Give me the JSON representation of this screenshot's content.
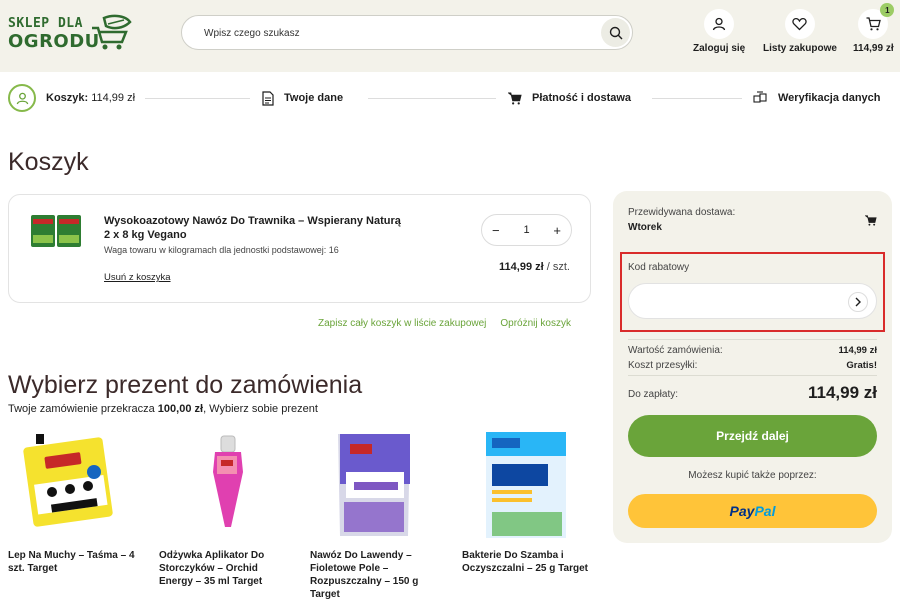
{
  "header": {
    "logo_line1": "SKLEP DLA",
    "logo_line2": "OGRODU",
    "search_placeholder": "Wpisz czego szukasz",
    "login_label": "Zaloguj się",
    "wishlist_label": "Listy zakupowe",
    "cart_total": "114,99 zł",
    "cart_count": "1"
  },
  "steps": [
    {
      "label": "Koszyk:",
      "value": "114,99 zł",
      "icon": "cart-check-icon"
    },
    {
      "label": "Twoje dane",
      "icon": "document-icon"
    },
    {
      "label": "Płatność i dostawa",
      "icon": "cart-icon"
    },
    {
      "label": "Weryfikacja danych",
      "icon": "boxes-icon"
    }
  ],
  "page_title": "Koszyk",
  "cart_item": {
    "name": "Wysokoazotowy Nawóz Do Trawnika – Wspierany Naturą 2 x 8 kg Vegano",
    "meta": "Waga towaru w kilogramach dla jednostki podstawowej: 16",
    "remove_label": "Usuń z koszyka",
    "quantity": "1",
    "minus": "−",
    "plus": "+",
    "price": "114,99 zł",
    "price_unit": "/ szt."
  },
  "cart_actions": {
    "save_list": "Zapisz cały koszyk w liście zakupowej",
    "empty_cart": "Opróżnij koszyk"
  },
  "gifts": {
    "title": "Wybierz prezent do zamówienia",
    "subtitle_pre": "Twoje zamówienie przekracza ",
    "subtitle_amount": "100,00 zł",
    "subtitle_post": ", Wybierz sobie prezent",
    "items": [
      {
        "name": "Lep Na Muchy – Taśma – 4 szt. Target"
      },
      {
        "name": "Odżywka Aplikator Do Storczyków – Orchid Energy – 35 ml Target"
      },
      {
        "name": "Nawóz Do Lawendy – Fioletowe Pole – Rozpuszczalny – 150 g Target"
      },
      {
        "name": "Bakterie Do Szamba i Oczyszczalni – 25 g Target"
      }
    ]
  },
  "summary": {
    "delivery_label": "Przewidywana dostawa:",
    "delivery_day": "Wtorek",
    "coupon_label": "Kod rabatowy",
    "coupon_value": "",
    "order_value_label": "Wartość zamówienia:",
    "order_value": "114,99 zł",
    "shipping_label": "Koszt przesyłki:",
    "shipping_value": "Gratis!",
    "total_label": "Do zapłaty:",
    "total_value": "114,99 zł",
    "next_button": "Przejdź dalej",
    "alt_payment": "Możesz kupić także poprzez:",
    "paypal_part1": "Pay",
    "paypal_part2": "Pal"
  },
  "colors": {
    "brand_green": "#6aa43a",
    "header_bg": "#f3f2ea",
    "highlight_red": "#d92b2b",
    "paypal_yellow": "#ffc439"
  }
}
